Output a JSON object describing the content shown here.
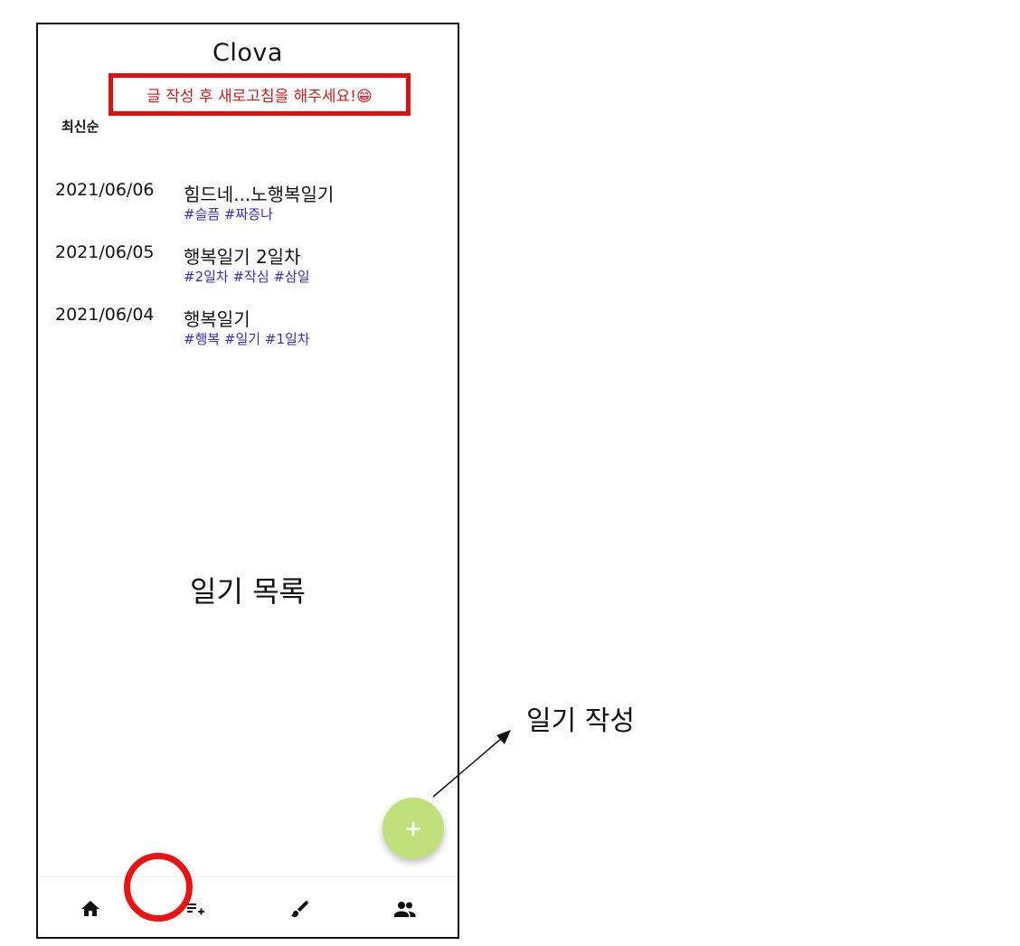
{
  "app": {
    "title": "Clova"
  },
  "notice": {
    "text": "글 작성 후 새로고침을 해주세요!😁"
  },
  "sort": {
    "label": "최신순"
  },
  "diaries": [
    {
      "date": "2021/06/06",
      "title": "힘드네...노행복일기",
      "tags": "#슬픔  #짜증나"
    },
    {
      "date": "2021/06/05",
      "title": "행복일기 2일차",
      "tags": "#2일차 #작심 #삼일"
    },
    {
      "date": "2021/06/04",
      "title": "행복일기",
      "tags": "#행복 #일기 #1일차"
    }
  ],
  "caption": {
    "text": "일기 목록"
  },
  "fab": {
    "symbol": "+",
    "color": "#bfe07a",
    "icon": "plus-icon"
  },
  "annotation": {
    "label": "일기 작성"
  },
  "bottom_nav": [
    {
      "icon": "home-icon"
    },
    {
      "icon": "playlist-add-icon",
      "highlighted": true
    },
    {
      "icon": "brush-icon"
    },
    {
      "icon": "people-icon"
    }
  ],
  "colors": {
    "notice_border": "#e01010",
    "notice_text": "#d11a1a",
    "tag_text": "#3a2fb8",
    "highlight": "#ee1111"
  }
}
